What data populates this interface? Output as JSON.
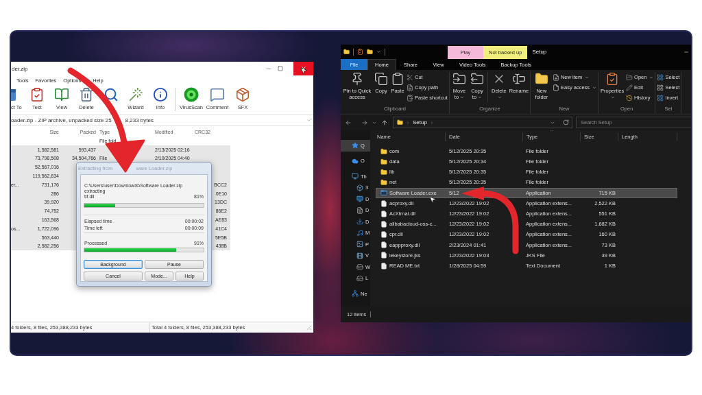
{
  "archive_window": {
    "title": "der.zip",
    "menu": [
      "Tools",
      "Favorites",
      "Options",
      "Help"
    ],
    "toolbar": [
      {
        "kind": "extract",
        "label": "ct To"
      },
      {
        "kind": "test",
        "label": "Test"
      },
      {
        "kind": "view",
        "label": "View"
      },
      {
        "kind": "delete",
        "label": "Delete"
      },
      {
        "kind": "find"
      },
      {
        "kind": "wizard",
        "label": "Wizard"
      },
      {
        "kind": "info",
        "label": "Info"
      },
      {
        "kind": "separator"
      },
      {
        "kind": "virusscan",
        "label": "VirusScan"
      },
      {
        "kind": "comment",
        "label": "Comment"
      },
      {
        "kind": "sfx",
        "label": "SFX"
      }
    ],
    "path": [
      "oader.zip - ZIP archive, unpacked size 25",
      "8,233 bytes"
    ],
    "columns": [
      "Size",
      "Packed",
      "Type",
      "Modified",
      "CRC32"
    ],
    "rows": [
      {
        "type": "File fold",
        "selected": false
      },
      {
        "size": "1,582,581",
        "packed": "593,437",
        "modified": "2/13/2025 02:16",
        "selected": true
      },
      {
        "size": "73,798,508",
        "packed": "34,504,766",
        "type": "File",
        "modified": "2/10/2025 04:40",
        "selected": true
      },
      {
        "size": "52,567,016",
        "selected": true
      },
      {
        "size": "119,562,634",
        "selected": true
      },
      {
        "name": "er...",
        "size": "731,176",
        "crc": "BCC2",
        "selected": true
      },
      {
        "size": "286",
        "crc": "0E10",
        "selected": true
      },
      {
        "size": "39,920",
        "crc": "13DC",
        "selected": true
      },
      {
        "size": "74,752",
        "crc": "86E2",
        "selected": true
      },
      {
        "size": "163,568",
        "crc": "AE83",
        "selected": true
      },
      {
        "name": "os...",
        "size": "1,722,096",
        "crc": "41C4",
        "selected": true
      },
      {
        "size": "563,440",
        "crc": "5E5B",
        "selected": true
      },
      {
        "size": "2,582,256",
        "crc": "438B",
        "selected": true
      }
    ],
    "status": [
      "4 folders, 8 files, 253,388,233 bytes",
      "Total 4 folders, 8 files, 253,388,233 bytes"
    ]
  },
  "extract_dialog": {
    "title": [
      "Extracting from",
      "ware Loader.zip"
    ],
    "archive": "C:\\Users\\user\\Downloads\\Software Loader.zip",
    "action": "extracting",
    "file": "tif.dll",
    "file_percent": "81%",
    "file_progress": {
      "level": 0.26
    },
    "times": [
      {
        "label": "Elapsed time",
        "value": "00:00:02"
      },
      {
        "label": "Time left",
        "value": "00:00:09"
      }
    ],
    "processed_label": "Processed",
    "processed_percent": "91%",
    "total_progress": {
      "level": 0.77
    },
    "buttons": [
      {
        "label": "Background",
        "focused": true
      },
      {
        "label": "Pause",
        "focused": false
      },
      {
        "label": "Cancel",
        "focused": false
      },
      {
        "label": "Mode...",
        "focused": false
      },
      {
        "label": "Help",
        "focused": false
      }
    ]
  },
  "explorer": {
    "context_tabs": [
      {
        "label": "Play",
        "color": "#f6b8d8"
      },
      {
        "label": "Not backed up",
        "color": "#f1ee7e"
      }
    ],
    "title": "Setup",
    "tabs": [
      {
        "label": "File",
        "kind": "menu",
        "selected": false
      },
      {
        "label": "Home",
        "kind": "tab",
        "selected": true
      },
      {
        "label": "Share",
        "kind": "tab",
        "selected": false
      },
      {
        "label": "View",
        "kind": "tab",
        "selected": false
      },
      {
        "label": "Video Tools",
        "kind": "tab",
        "selected": false
      },
      {
        "label": "Backup Tools",
        "kind": "tab",
        "selected": false
      }
    ],
    "ribbon": [
      {
        "label": "Clipboard",
        "items": [
          {
            "kind": "pin",
            "label": "Pin to Quick access",
            "dropdown": false
          },
          {
            "kind": "copy",
            "label": "Copy",
            "dropdown": false
          },
          {
            "kind": "paste",
            "label": "Paste",
            "dropdown": false
          },
          {
            "kind": "cut",
            "label": "Cut",
            "dropdown": false
          },
          {
            "kind": "copy_path",
            "label": "Copy path",
            "dropdown": false
          },
          {
            "kind": "paste_shortcut",
            "label": "Paste shortcut",
            "dropdown": false
          }
        ]
      },
      {
        "label": "Organize",
        "items": [
          {
            "kind": "move",
            "label": "Move to",
            "dropdown": true
          },
          {
            "kind": "copy_to",
            "label": "Copy to",
            "dropdown": true
          },
          {
            "kind": "separator"
          },
          {
            "kind": "delete",
            "label": "Delete",
            "dropdown": true
          },
          {
            "kind": "rename",
            "label": "Rename",
            "dropdown": false
          }
        ]
      },
      {
        "label": "New",
        "items": [
          {
            "kind": "new_folder",
            "label": "New folder",
            "dropdown": false
          },
          {
            "kind": "new_item",
            "label": "New item",
            "dropdown": true
          },
          {
            "kind": "easy_access",
            "label": "Easy access",
            "dropdown": true
          }
        ]
      },
      {
        "label": "Open",
        "items": [
          {
            "kind": "properties",
            "label": "Properties",
            "dropdown": true
          },
          {
            "kind": "open",
            "label": "Open",
            "dropdown": true
          },
          {
            "kind": "edit",
            "label": "Edit",
            "dropdown": false
          },
          {
            "kind": "history",
            "label": "History",
            "dropdown": false
          }
        ]
      },
      {
        "label": "Sel",
        "items": [
          {
            "kind": "select_all",
            "label": "Select",
            "dropdown": false
          },
          {
            "kind": "select_none",
            "label": "Select",
            "dropdown": false
          },
          {
            "kind": "invert",
            "label": "Invert",
            "dropdown": false
          }
        ]
      }
    ],
    "address": {
      "crumbs": [
        "Setup"
      ]
    },
    "search_placeholder": "Search Setup",
    "nav": [
      {
        "label": "Q",
        "kind": "quick_access",
        "selected": true
      },
      {
        "label": "O",
        "kind": "onedrive",
        "selected": false
      },
      {
        "label": "Th",
        "kind": "pc",
        "selected": false,
        "children": [
          {
            "label": "3",
            "kind": "objects3d",
            "selected": false
          },
          {
            "label": "D",
            "kind": "desktop",
            "selected": false
          },
          {
            "label": "D",
            "kind": "documents",
            "selected": false
          },
          {
            "label": "D",
            "kind": "downloads",
            "selected": false
          },
          {
            "label": "M",
            "kind": "music",
            "selected": false
          },
          {
            "label": "P",
            "kind": "pictures",
            "selected": false
          },
          {
            "label": "V",
            "kind": "videos",
            "selected": false
          },
          {
            "label": "W",
            "kind": "drive",
            "selected": false
          },
          {
            "label": "L",
            "kind": "drive",
            "selected": false
          }
        ]
      },
      {
        "label": "Ne",
        "kind": "network",
        "selected": false
      }
    ],
    "columns": [
      {
        "label": "Name",
        "sorted": false
      },
      {
        "label": "Date",
        "sorted": false
      },
      {
        "label": "Type",
        "sorted": true
      },
      {
        "label": "Size",
        "sorted": false
      },
      {
        "label": "Length",
        "sorted": false
      }
    ],
    "files": [
      {
        "name": "com",
        "date": "5/12/2025 20:35",
        "type": "File folder",
        "kind": "folder",
        "selected": false
      },
      {
        "name": "data",
        "date": "5/12/2025 20:34",
        "type": "File folder",
        "kind": "folder",
        "selected": false
      },
      {
        "name": "lib",
        "date": "5/12/2025 20:35",
        "type": "File folder",
        "kind": "folder",
        "selected": false
      },
      {
        "name": "net",
        "date": "5/12/2025 20:35",
        "type": "File folder",
        "kind": "folder",
        "selected": false
      },
      {
        "name": "Software Loader.exe",
        "date": "5/12",
        "type": "Application",
        "size": "715 KB",
        "kind": "application",
        "selected": true
      },
      {
        "name": "acproxy.dll",
        "date": "12/23/2022 19:02",
        "type": "Application extens...",
        "size": "2,522 KB",
        "kind": "file",
        "selected": false
      },
      {
        "name": "AcXtrnal.dll",
        "date": "12/23/2022 19:02",
        "type": "Application extens...",
        "size": "551 KB",
        "kind": "file",
        "selected": false
      },
      {
        "name": "alibabacloud-oss-c...",
        "date": "12/23/2022 19:02",
        "type": "Application extens...",
        "size": "1,682 KB",
        "kind": "file",
        "selected": false
      },
      {
        "name": "cpr.dll",
        "date": "12/23/2022 19:02",
        "type": "Application extens...",
        "size": "160 KB",
        "kind": "file",
        "selected": false
      },
      {
        "name": "eappproxy.dll",
        "date": "2/23/2024 01:41",
        "type": "Application extens...",
        "size": "73 KB",
        "kind": "file",
        "selected": false
      },
      {
        "name": "lekeystore.jks",
        "date": "12/23/2022 19:03",
        "type": "JKS File",
        "size": "39 KB",
        "kind": "file",
        "selected": false
      },
      {
        "name": "READ ME.txt",
        "date": "1/28/2025 04:59",
        "type": "Text Document",
        "size": "1 KB",
        "kind": "text",
        "selected": false
      }
    ],
    "status": "12 items"
  }
}
